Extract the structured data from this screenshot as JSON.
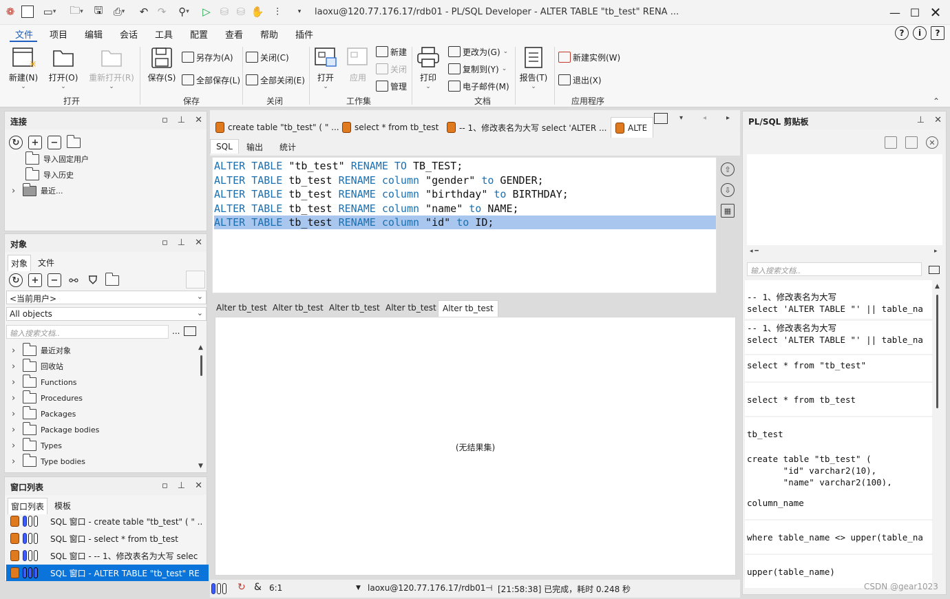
{
  "titlebar": {
    "title": "laoxu@120.77.176.17/rdb01 - PL/SQL Developer - ALTER TABLE \"tb_test\" RENA ...",
    "minimize_icon": "minimize-icon",
    "maximize_icon": "maximize-icon",
    "close_icon": "close-icon"
  },
  "menu": [
    "文件",
    "项目",
    "编辑",
    "会话",
    "工具",
    "配置",
    "查看",
    "帮助",
    "插件"
  ],
  "ribbon": {
    "new_label": "新建(N)",
    "open_label": "打开(O)",
    "reopen_label": "重新打开(R)",
    "group_open": "打开",
    "save_label": "保存(S)",
    "save_as_label": "另存为(A)",
    "save_all_label": "全部保存(L)",
    "group_save": "保存",
    "close_label": "关闭(C)",
    "close_all_label": "全部关闭(E)",
    "group_close": "关闭",
    "ws_open_label": "打开",
    "ws_apply_label": "应用",
    "ws_new_label": "新建",
    "ws_close_label": "关闭",
    "ws_manage_label": "管理",
    "group_workspace": "工作集",
    "print_label": "打印",
    "change_to_label": "更改为(G)",
    "copy_to_label": "复制到(Y)",
    "email_label": "电子邮件(M)",
    "group_doc": "文档",
    "report_label": "报告(T)",
    "new_instance_label": "新建实例(W)",
    "exit_label": "退出(X)",
    "group_app": "应用程序"
  },
  "conn_panel": {
    "title": "连接",
    "items": [
      "导入固定用户",
      "导入历史",
      "最近..."
    ]
  },
  "obj_panel": {
    "title": "对象",
    "tabs": [
      "对象",
      "文件"
    ],
    "user_combo": "<当前用户>",
    "type_combo": "All objects",
    "search_placeholder": "输入搜索文档..",
    "more": "...",
    "items": [
      "最近对象",
      "回收站",
      "Functions",
      "Procedures",
      "Packages",
      "Package bodies",
      "Types",
      "Type bodies"
    ]
  },
  "winlist_panel": {
    "title": "窗口列表",
    "tabs": [
      "窗口列表",
      "模板"
    ],
    "rows": [
      "SQL 窗口 - create table \"tb_test\" ( \" ..",
      "SQL 窗口 - select * from tb_test",
      "SQL 窗口 - -- 1、修改表名为大写 selec",
      "SQL 窗口 - ALTER TABLE \"tb_test\" RE"
    ]
  },
  "doc_tabs": [
    "create table \"tb_test\" ( \" ...",
    "select * from tb_test",
    "-- 1、修改表名为大写 select 'ALTER ...",
    "ALTE"
  ],
  "editor_tabs": [
    "SQL",
    "输出",
    "统计"
  ],
  "code_lines": [
    [
      "ALTER TABLE",
      " \"tb_test\" ",
      "RENAME TO",
      " TB_TEST;",
      "",
      ""
    ],
    [
      "ALTER TABLE",
      " tb_test ",
      "RENAME column",
      " \"gender\" ",
      "to",
      " GENDER;"
    ],
    [
      "ALTER TABLE",
      " tb_test ",
      "RENAME column",
      " \"birthday\" ",
      "to",
      " BIRTHDAY;"
    ],
    [
      "ALTER TABLE",
      " tb_test ",
      "RENAME column",
      " \"name\" ",
      "to",
      " NAME;"
    ],
    [
      "ALTER TABLE",
      " tb_test ",
      "RENAME column",
      " \"id\" ",
      "to",
      " ID;"
    ]
  ],
  "result_tabs": [
    "Alter tb_test",
    "Alter tb_test",
    "Alter tb_test",
    "Alter tb_test",
    "Alter tb_test"
  ],
  "result_empty": "(无结果集)",
  "status": {
    "position": "6:1",
    "connection": "laoxu@120.77.176.17/rdb01",
    "message": "[21:58:38]  已完成，耗时 0.248 秒"
  },
  "clipboard": {
    "title": "PL/SQL 剪贴板",
    "search_placeholder": "输入搜索文档..",
    "items": [
      "-- 1、修改表名为大写\nselect 'ALTER TABLE \"' || table_na",
      "-- 1、修改表名为大写\nselect 'ALTER TABLE \"' || table_na",
      "select * from \"tb_test\"",
      "select * from tb_test",
      "tb_test",
      "create table \"tb_test\" (\n       \"id\" varchar2(10),\n       \"name\" varchar2(100),",
      "column_name",
      "where table_name <> upper(table_na",
      "upper(table_name)"
    ]
  },
  "watermark": "CSDN @gear1023"
}
